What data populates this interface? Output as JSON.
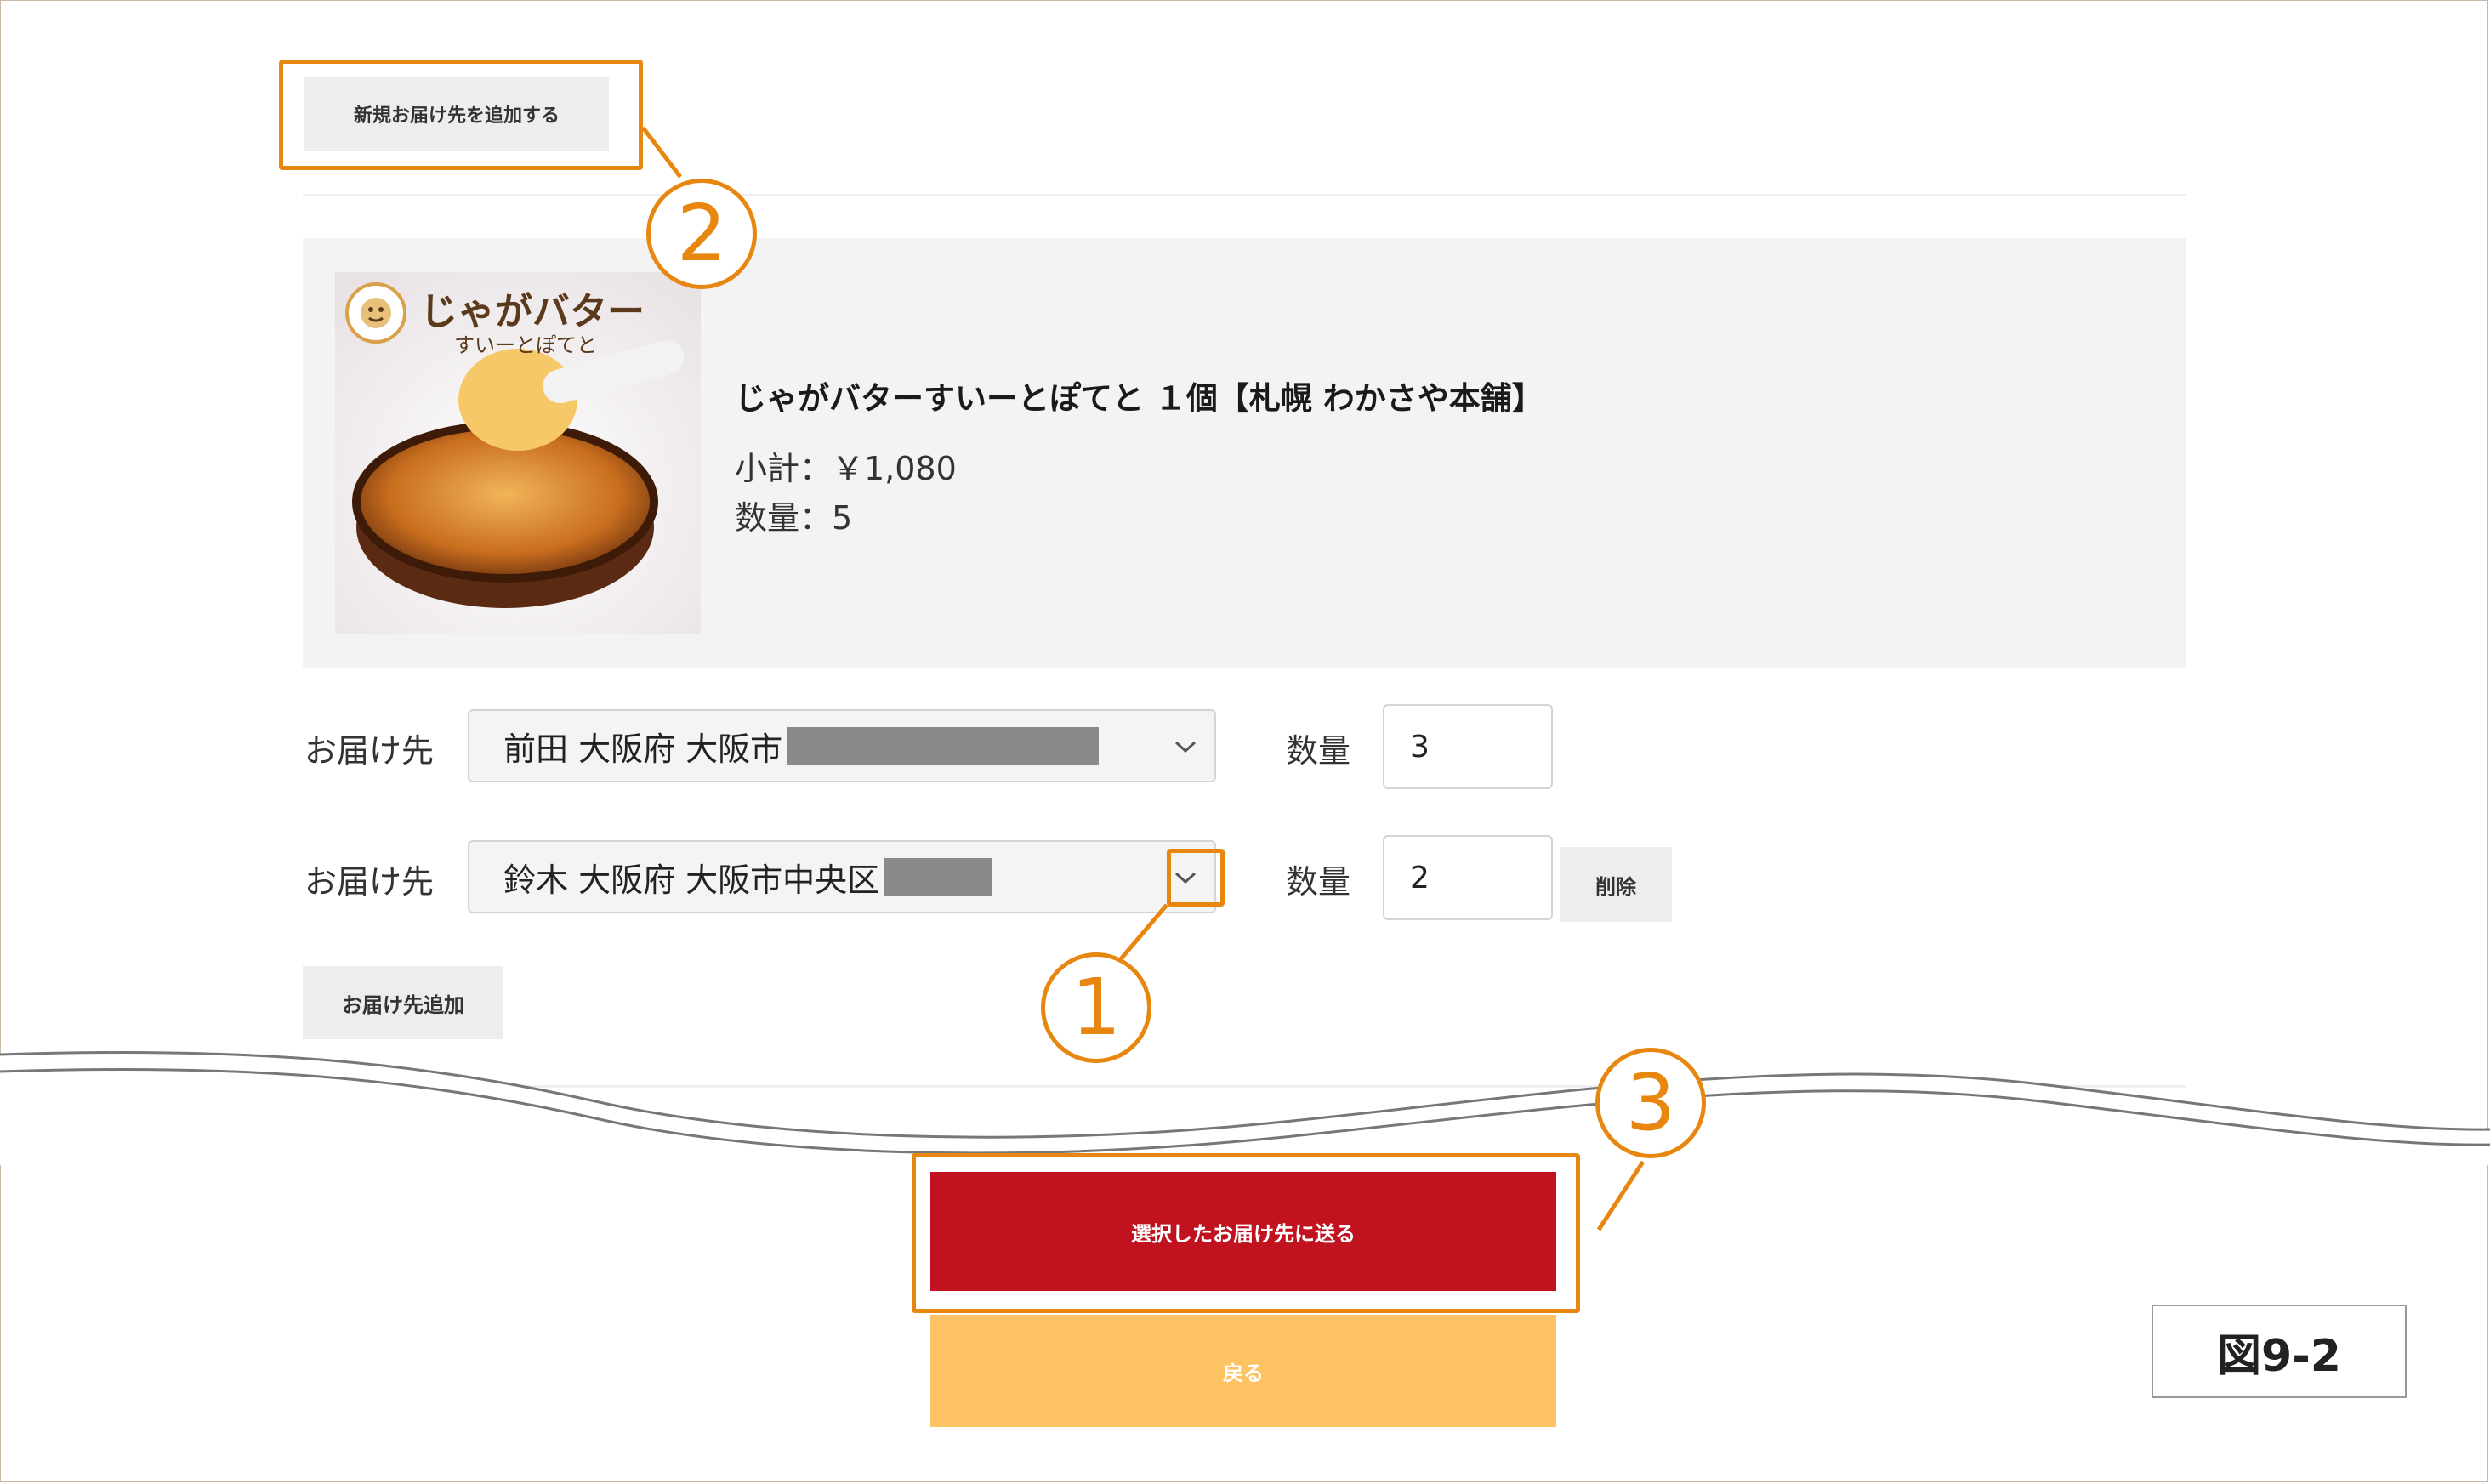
{
  "top_button": {
    "label": "新規お届け先を追加する"
  },
  "product": {
    "image_title": "じゃがバター",
    "image_subtitle": "すいーとぽてと",
    "name": "じゃがバターすいーとぽてと １個【札幌 わかさや本舗】",
    "subtotal": "小計：￥1,080",
    "quantity": "数量：5"
  },
  "rows": [
    {
      "label": "お届け先",
      "address": "前田 大阪府 大阪市",
      "qty_label": "数量",
      "qty": "3"
    },
    {
      "label": "お届け先",
      "address": "鈴木 大阪府 大阪市中央区",
      "qty_label": "数量",
      "qty": "2",
      "delete_label": "削除"
    }
  ],
  "add_destination": {
    "label": "お届け先追加"
  },
  "submit": {
    "label": "選択したお届け先に送る",
    "color": "#c1121f"
  },
  "back": {
    "label": "戻る",
    "color": "#fdc363"
  },
  "callouts": {
    "one": "1",
    "two": "2",
    "three": "3"
  },
  "figure_label": "図9-2",
  "colors": {
    "accent": "#e8870f",
    "panel": "#f3f3f3"
  },
  "icons": {
    "dropdown": "chevron-down-icon"
  }
}
